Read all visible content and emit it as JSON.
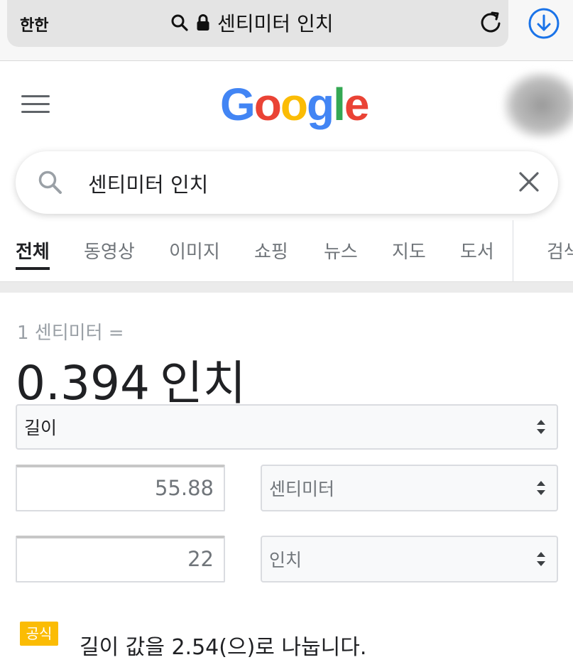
{
  "browser": {
    "aa_label": "한한",
    "url_text": "센티미터 인치"
  },
  "logo": {
    "letters": [
      "G",
      "o",
      "o",
      "g",
      "l",
      "e"
    ]
  },
  "search": {
    "query": "센티미터 인치"
  },
  "tabs": [
    {
      "label": "전체",
      "active": true
    },
    {
      "label": "동영상",
      "active": false
    },
    {
      "label": "이미지",
      "active": false
    },
    {
      "label": "쇼핑",
      "active": false
    },
    {
      "label": "뉴스",
      "active": false
    },
    {
      "label": "지도",
      "active": false
    },
    {
      "label": "도서",
      "active": false
    },
    {
      "label": "검색",
      "active": false
    }
  ],
  "converter": {
    "equation_small": "1 센티미터 =",
    "result_value": "0.394",
    "result_unit": "인치",
    "measure": "길이",
    "from_value": "55.88",
    "from_unit": "센티미터",
    "to_value": "22",
    "to_unit": "인치",
    "formula_badge": "공식",
    "formula_text": "길이 값을 2.54(으)로 나눕니다."
  },
  "colors": {
    "google_blue": "#4285f4",
    "google_red": "#ea4335",
    "google_yellow": "#fbbc05",
    "google_green": "#34a853",
    "formula_badge": "#fbbc04",
    "download_icon": "#1a73e8"
  },
  "icons": [
    "search-icon",
    "lock-icon",
    "reload-icon",
    "download-icon",
    "menu-icon",
    "close-icon",
    "sort-arrows-icon"
  ]
}
